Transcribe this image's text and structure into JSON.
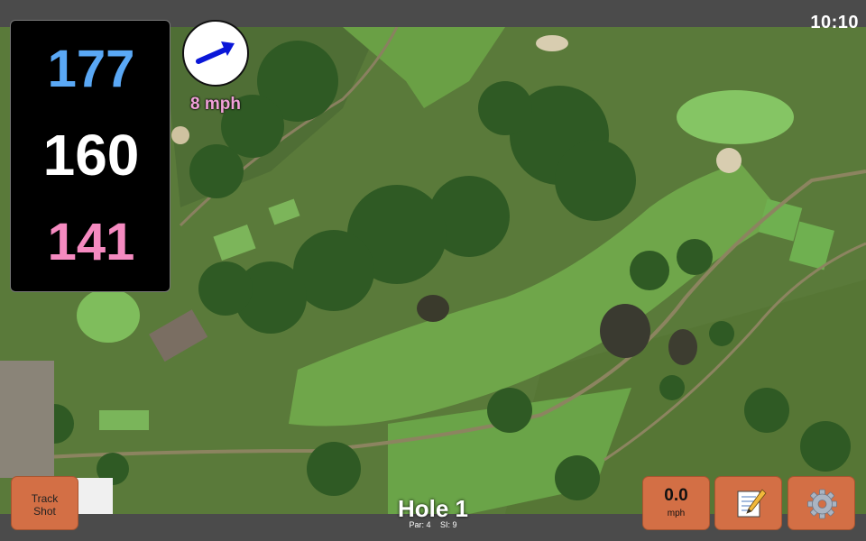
{
  "status_bar": {
    "time": "10:10"
  },
  "distances": {
    "back": "177",
    "middle": "160",
    "front": "141"
  },
  "wind": {
    "speed_label": "8 mph",
    "direction_icon": "arrow-icon"
  },
  "buttons": {
    "track_shot_line1": "Track",
    "track_shot_line2": "Shot",
    "wind_value": "0.0",
    "wind_unit": "mph",
    "notes_icon": "notepad-icon",
    "settings_icon": "gear-icon"
  },
  "hole": {
    "title": "Hole 1",
    "par": "Par: 4",
    "si": "SI: 9"
  },
  "colors": {
    "back": "#5aa8f5",
    "middle": "#ffffff",
    "front": "#f58ac0",
    "button": "#d36f45"
  }
}
